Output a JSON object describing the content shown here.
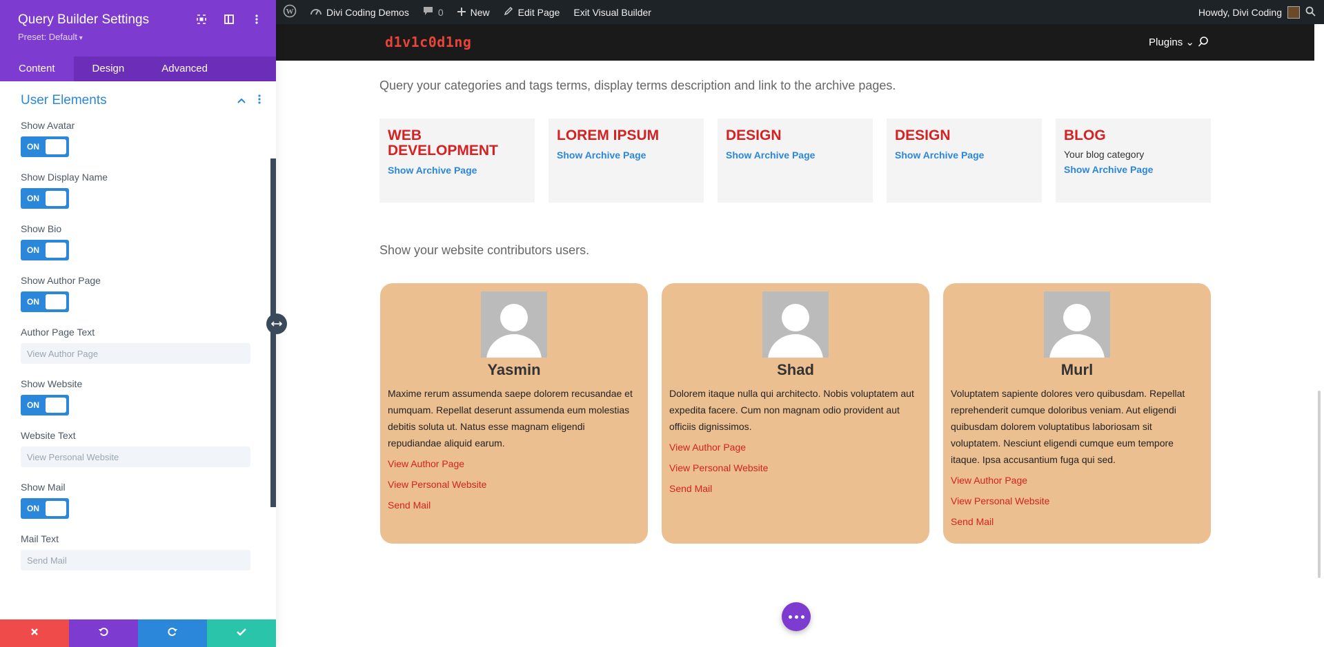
{
  "panel": {
    "title": "Query Builder Settings",
    "preset": "Preset: Default",
    "tabs": [
      {
        "label": "Content",
        "active": true
      },
      {
        "label": "Design",
        "active": false
      },
      {
        "label": "Advanced",
        "active": false
      }
    ],
    "section_title": "User Elements",
    "fields": {
      "show_avatar": {
        "label": "Show Avatar",
        "toggle": "ON"
      },
      "show_display_name": {
        "label": "Show Display Name",
        "toggle": "ON"
      },
      "show_bio": {
        "label": "Show Bio",
        "toggle": "ON"
      },
      "show_author_page": {
        "label": "Show Author Page",
        "toggle": "ON"
      },
      "author_page_text": {
        "label": "Author Page Text",
        "placeholder": "View Author Page"
      },
      "show_website": {
        "label": "Show Website",
        "toggle": "ON"
      },
      "website_text": {
        "label": "Website Text",
        "placeholder": "View Personal Website"
      },
      "show_mail": {
        "label": "Show Mail",
        "toggle": "ON"
      },
      "mail_text": {
        "label": "Mail Text",
        "placeholder": "Send Mail"
      }
    },
    "footer_colors": {
      "discard": "#ef4b4b",
      "undo": "#7e3bd0",
      "redo": "#2b87da",
      "save": "#29c4a9"
    }
  },
  "adminbar": {
    "site_name": "Divi Coding Demos",
    "comments_count": "0",
    "new_label": "New",
    "edit_label": "Edit Page",
    "exit_label": "Exit Visual Builder",
    "greeting": "Howdy, Divi Coding"
  },
  "site": {
    "logo": "d1v1c0d1ng",
    "nav_item": "Plugins"
  },
  "content": {
    "terms_intro": "Query your categories and tags terms, display terms description and link to the archive pages.",
    "terms": [
      {
        "name": "WEB DEVELOPMENT",
        "desc": "",
        "link": "Show Archive Page"
      },
      {
        "name": "LOREM IPSUM",
        "desc": "",
        "link": "Show Archive Page"
      },
      {
        "name": "DESIGN",
        "desc": "",
        "link": "Show Archive Page"
      },
      {
        "name": "DESIGN",
        "desc": "",
        "link": "Show Archive Page"
      },
      {
        "name": "BLOG",
        "desc": "Your blog category",
        "link": "Show Archive Page"
      }
    ],
    "users_intro": "Show your website contributors users.",
    "users": [
      {
        "name": "Yasmin",
        "bio": "Maxime rerum assumenda saepe dolorem recusandae et numquam. Repellat deserunt assumenda eum molestias debitis soluta ut. Natus esse magnam eligendi repudiandae aliquid earum.",
        "author_link": "View Author Page",
        "website_link": "View Personal Website",
        "mail_link": "Send Mail"
      },
      {
        "name": "Shad",
        "bio": "Dolorem itaque nulla qui architecto. Nobis voluptatem aut expedita facere. Cum non magnam odio provident aut officiis dignissimos.",
        "author_link": "View Author Page",
        "website_link": "View Personal Website",
        "mail_link": "Send Mail"
      },
      {
        "name": "Murl",
        "bio": "Voluptatem sapiente dolores vero quibusdam. Repellat reprehenderit cumque doloribus veniam. Aut eligendi quibusdam dolorem voluptatibus laboriosam sit voluptatem. Nesciunt eligendi cumque eum tempore itaque. Ipsa accusantium fuga qui sed.",
        "author_link": "View Author Page",
        "website_link": "View Personal Website",
        "mail_link": "Send Mail"
      }
    ]
  }
}
